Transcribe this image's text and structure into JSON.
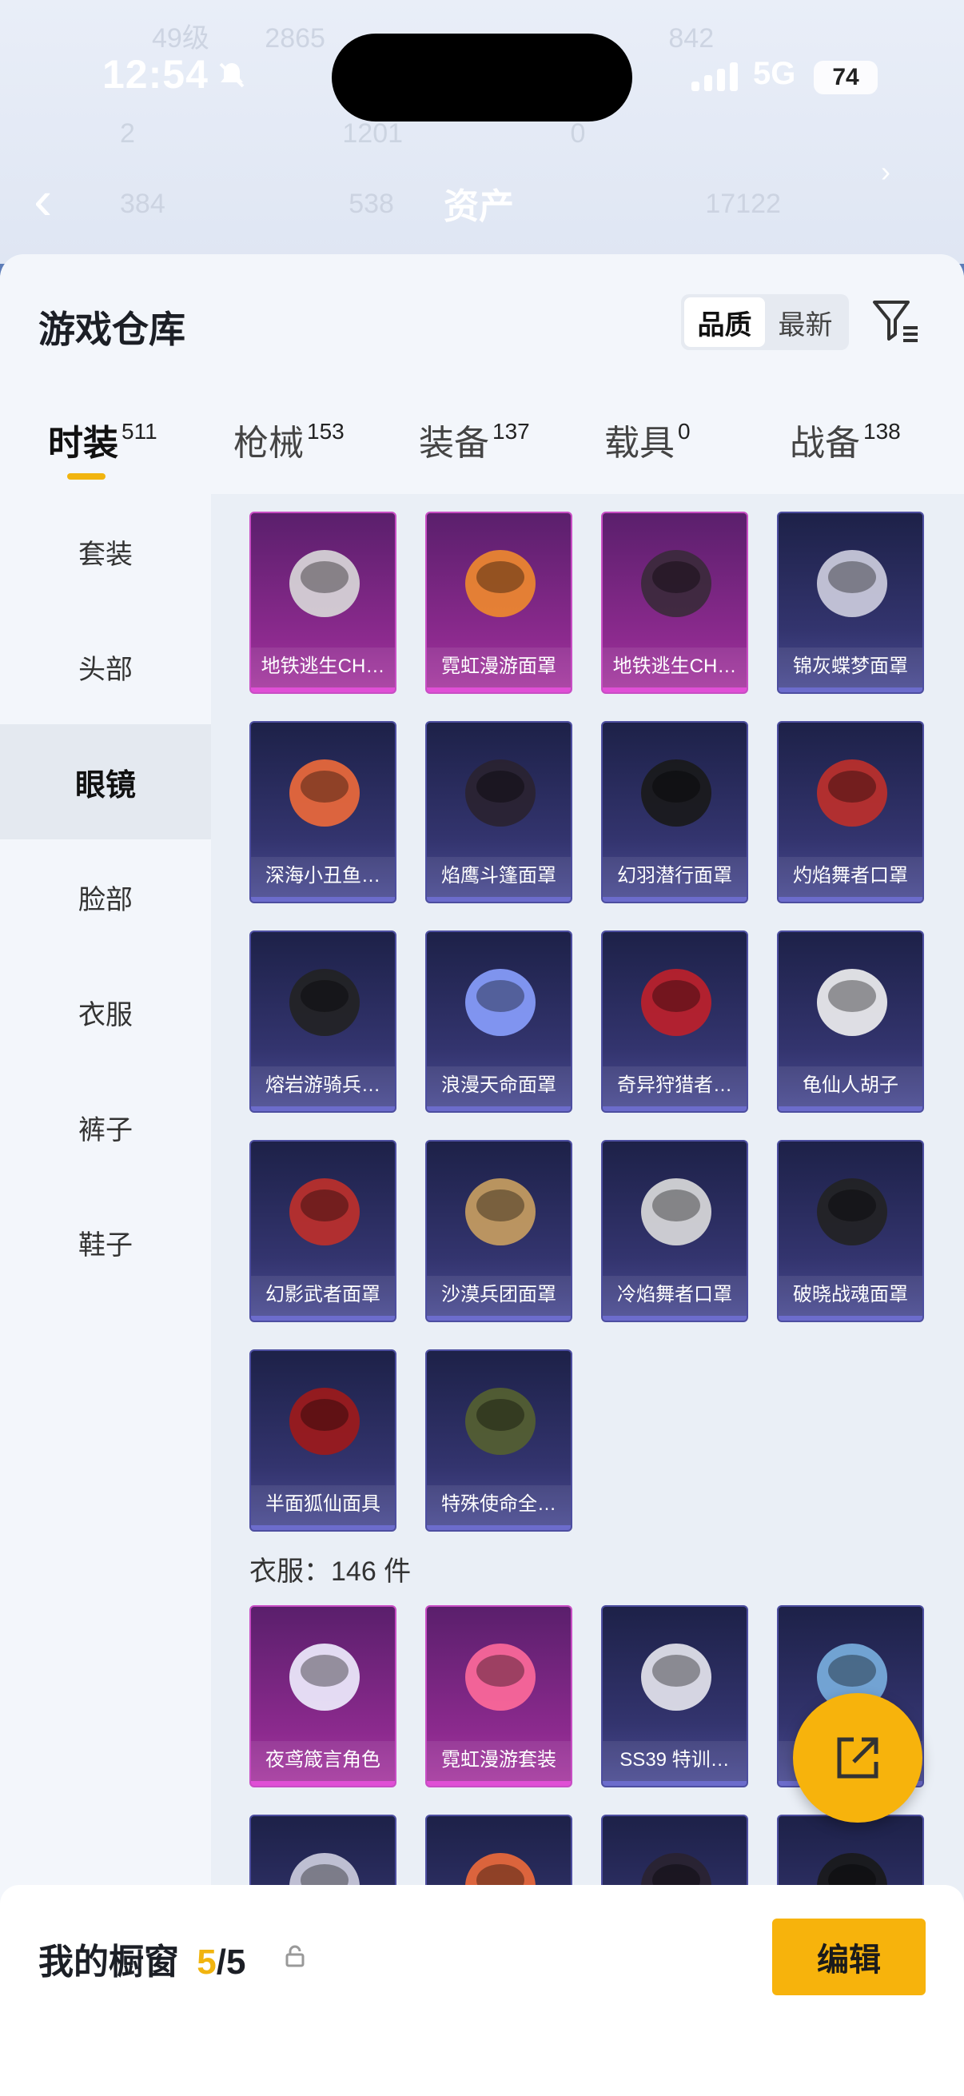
{
  "status_bar": {
    "time": "12:54",
    "network": "5G",
    "battery": "74"
  },
  "header": {
    "title": "资产"
  },
  "background_stats": {
    "level": "49级",
    "stat_a": "2865",
    "stat_b": "842",
    "row2": [
      "2",
      "1201",
      "0"
    ],
    "row3": [
      "384",
      "538",
      "17122"
    ]
  },
  "warehouse": {
    "title": "游戏仓库",
    "sort_options": [
      "品质",
      "最新"
    ],
    "active_sort": "品质"
  },
  "tabs": [
    {
      "label": "时装",
      "count": "511"
    },
    {
      "label": "枪械",
      "count": "153"
    },
    {
      "label": "装备",
      "count": "137"
    },
    {
      "label": "载具",
      "count": "0"
    },
    {
      "label": "战备",
      "count": "138"
    }
  ],
  "sidebar": [
    "套装",
    "头部",
    "眼镜",
    "脸部",
    "衣服",
    "裤子",
    "鞋子"
  ],
  "items": [
    {
      "name": "地铁逃生CH…",
      "rarity": "purple"
    },
    {
      "name": "霓虹漫游面罩",
      "rarity": "purple"
    },
    {
      "name": "地铁逃生CH…",
      "rarity": "purple"
    },
    {
      "name": "锦灰蝶梦面罩",
      "rarity": "blue"
    },
    {
      "name": "深海小丑鱼…",
      "rarity": "blue"
    },
    {
      "name": "焰鹰斗篷面罩",
      "rarity": "blue"
    },
    {
      "name": "幻羽潜行面罩",
      "rarity": "blue"
    },
    {
      "name": "灼焰舞者口罩",
      "rarity": "blue"
    },
    {
      "name": "熔岩游骑兵…",
      "rarity": "blue"
    },
    {
      "name": "浪漫天命面罩",
      "rarity": "blue"
    },
    {
      "name": "奇异狩猎者…",
      "rarity": "blue"
    },
    {
      "name": "龟仙人胡子",
      "rarity": "blue"
    },
    {
      "name": "幻影武者面罩",
      "rarity": "blue"
    },
    {
      "name": "沙漠兵团面罩",
      "rarity": "blue"
    },
    {
      "name": "冷焰舞者口罩",
      "rarity": "blue"
    },
    {
      "name": "破晓战魂面罩",
      "rarity": "blue"
    },
    {
      "name": "半面狐仙面具",
      "rarity": "blue"
    },
    {
      "name": "特殊使命全…",
      "rarity": "blue"
    }
  ],
  "clothes_section": {
    "label": "衣服：146 件",
    "items": [
      {
        "name": "夜鸢箴言角色",
        "rarity": "purple"
      },
      {
        "name": "霓虹漫游套装",
        "rarity": "purple"
      },
      {
        "name": "SS39 特训…",
        "rarity": "blue"
      },
      {
        "name": "",
        "rarity": "blue"
      }
    ]
  },
  "showcase": {
    "label": "我的橱窗",
    "current": "5",
    "total": "/5"
  },
  "edit_button": "编辑"
}
